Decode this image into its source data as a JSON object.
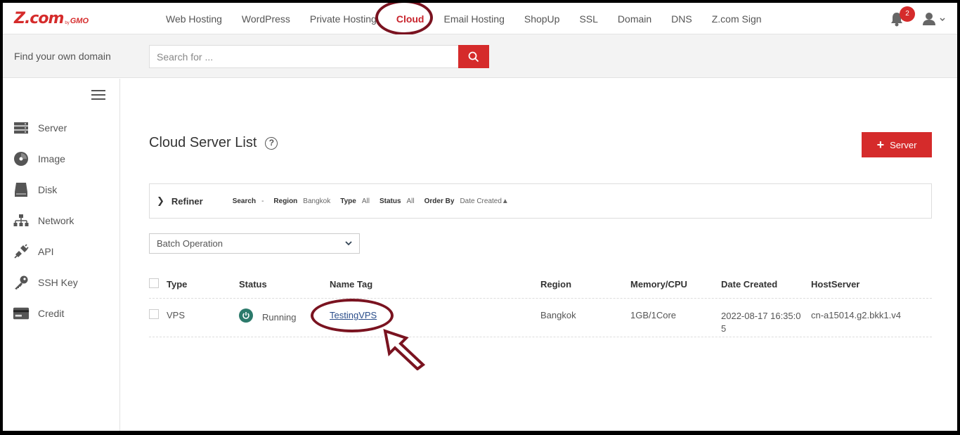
{
  "logo": {
    "main": "Z.com",
    "by": "by",
    "gmo": "GMO"
  },
  "nav": {
    "items": [
      "Web Hosting",
      "WordPress",
      "Private Hosting",
      "Cloud",
      "Email Hosting",
      "ShopUp",
      "SSL",
      "Domain",
      "DNS",
      "Z.com Sign"
    ],
    "active": "Cloud",
    "notification_count": "2"
  },
  "search": {
    "label": "Find your own domain",
    "placeholder": "Search for ..."
  },
  "sidebar": {
    "items": [
      {
        "label": "Server",
        "icon": "server-icon"
      },
      {
        "label": "Image",
        "icon": "image-disc-icon"
      },
      {
        "label": "Disk",
        "icon": "disk-icon"
      },
      {
        "label": "Network",
        "icon": "network-icon"
      },
      {
        "label": "API",
        "icon": "plug-icon"
      },
      {
        "label": "SSH Key",
        "icon": "key-icon"
      },
      {
        "label": "Credit",
        "icon": "credit-card-icon"
      }
    ]
  },
  "main": {
    "title": "Cloud Server List",
    "help_label": "?",
    "add_server_label": "Server",
    "refiner": {
      "label": "Refiner",
      "filters": [
        {
          "key": "Search",
          "value": "-"
        },
        {
          "key": "Region",
          "value": "Bangkok"
        },
        {
          "key": "Type",
          "value": "All"
        },
        {
          "key": "Status",
          "value": "All"
        },
        {
          "key": "Order By",
          "value": "Date Created▲"
        }
      ]
    },
    "batch_operation": "Batch Operation",
    "table": {
      "headers": [
        "Type",
        "Status",
        "Name Tag",
        "Region",
        "Memory/CPU",
        "Date Created",
        "HostServer"
      ],
      "rows": [
        {
          "type": "VPS",
          "status": "Running",
          "name_tag": "TestingVPS",
          "region": "Bangkok",
          "memory_cpu": "1GB/1Core",
          "date_created": "2022-08-17 16:35:05",
          "host_server": "cn-a15014.g2.bkk1.v4"
        }
      ]
    }
  },
  "colors": {
    "accent": "#d52b2b",
    "annotation": "#7a1320",
    "running": "#2c7a6b"
  }
}
